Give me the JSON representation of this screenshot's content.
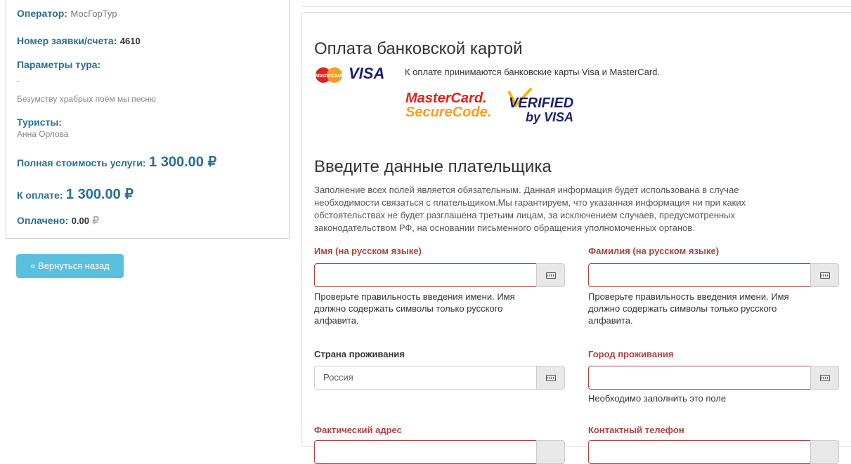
{
  "order": {
    "operator_label": "Оператор:",
    "operator_value": "МосГорТур",
    "number_label": "Номер заявки/счета:",
    "number_value": "4610",
    "tour_params_label": "Параметры тура:",
    "tour_params_dash": "-",
    "tour_params_text": "Безумству храбрых поём мы песню",
    "tourists_label": "Туристы:",
    "tourists_value": "Анна Орлова",
    "full_cost_label": "Полная стоимость услуги:",
    "full_cost_value": "1 300.00 ₽",
    "to_pay_label": "К оплате:",
    "to_pay_value": "1 300.00 ₽",
    "paid_label": "Оплачено:",
    "paid_value": "0.00",
    "paid_currency": "₽"
  },
  "back_button": "« Вернуться назад",
  "payment": {
    "title": "Оплата банковской картой",
    "cards_text": "К оплате принимаются банковские карты Visa и MasterCard.",
    "logos": {
      "mastercard_small": "MasterCard",
      "visa_small": "VISA",
      "mc_secure_line1": "MasterCard.",
      "mc_secure_line2": "SecureCode.",
      "vbv_line1": "VERIFIED",
      "vbv_line2": "by VISA"
    }
  },
  "payer": {
    "title": "Введите данные плательщика",
    "intro_lines": [
      "Заполнение всех полей является обязательным. Данная информация будет использована в случае",
      "необходимости связаться с плательщиком.Мы гарантируем, что указанная информация ни при каких",
      "обстоятельствах не будет разглашена третьим лицам, за исключением случаев, предусмотренных",
      "законодательством РФ, на основании письменного обращения уполномоченных органов."
    ],
    "first_name": {
      "label": "Имя (на русском языке)",
      "value": "",
      "help_lines": [
        "Проверьте правильность введения имени. Имя",
        "должно содержать символы только русского",
        "алфавита."
      ]
    },
    "last_name": {
      "label": "Фамилия (на русском языке)",
      "value": "",
      "help_lines": [
        "Проверьте правильность введения имени. Имя",
        "должно содержать символы только русского",
        "алфавита."
      ]
    },
    "country": {
      "label": "Страна проживания",
      "value": "Россия"
    },
    "city": {
      "label": "Город проживания",
      "value": "",
      "help": "Необходимо заполнить это поле"
    },
    "address": {
      "label": "Фактический адрес"
    },
    "phone": {
      "label": "Контактный телефон"
    }
  },
  "colors": {
    "accent": "#2a6f91",
    "error": "#a94442",
    "button": "#5bc0de"
  }
}
